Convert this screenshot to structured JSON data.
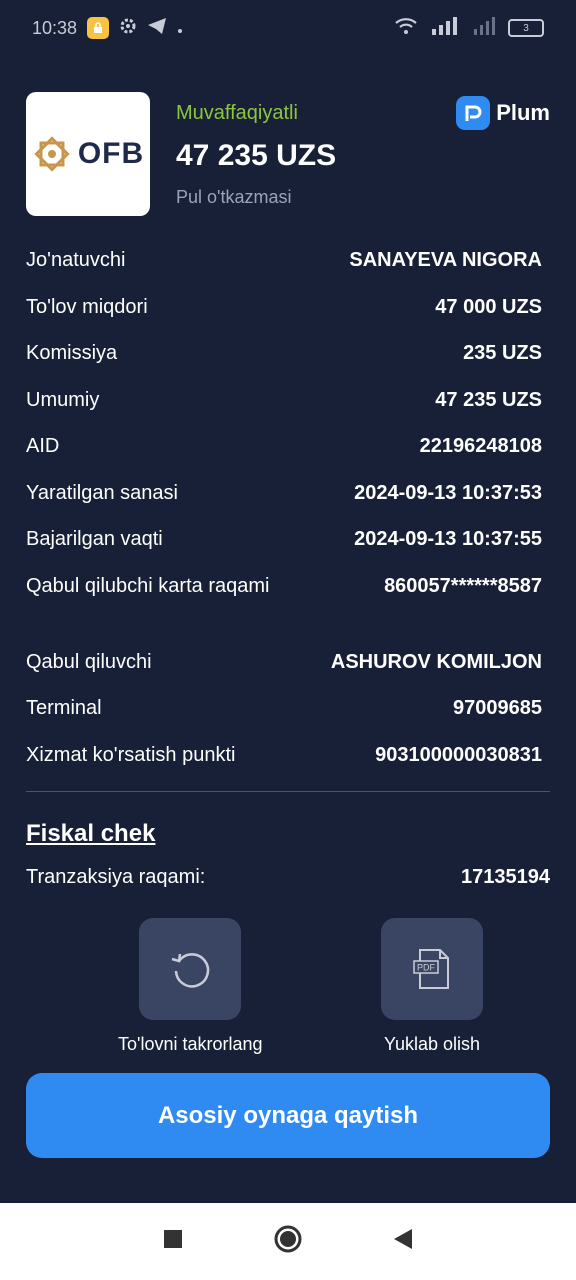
{
  "status_bar": {
    "time": "10:38",
    "battery": "3"
  },
  "header": {
    "bank_logo_text": "OFB",
    "status": "Muvaffaqiyatli",
    "amount": "47 235 UZS",
    "type": "Pul o'tkazmasi",
    "brand": "Plum"
  },
  "details": [
    {
      "label": "Jo'natuvchi",
      "value": "SANAYEVA NIGORA"
    },
    {
      "label": "To'lov miqdori",
      "value": "47 000 UZS"
    },
    {
      "label": "Komissiya",
      "value": "235 UZS"
    },
    {
      "label": "Umumiy",
      "value": "47 235 UZS"
    },
    {
      "label": "AID",
      "value": "22196248108"
    },
    {
      "label": "Yaratilgan sanasi",
      "value": "2024-09-13 10:37:53"
    },
    {
      "label": "Bajarilgan vaqti",
      "value": "2024-09-13 10:37:55"
    },
    {
      "label": "Qabul qilubchi karta raqami",
      "value": "860057******8587"
    },
    {
      "label": "Qabul qiluvchi",
      "value": "ASHUROV KOMILJON"
    },
    {
      "label": "Terminal",
      "value": "97009685"
    },
    {
      "label": "Xizmat ko'rsatish punkti",
      "value": "903100000030831"
    }
  ],
  "fiscal": {
    "title": "Fiskal chek",
    "tranz_label": "Tranzaksiya raqami:",
    "tranz_value": "17135194"
  },
  "actions": {
    "repeat_label": "To'lovni takrorlang",
    "download_label": "Yuklab olish",
    "pdf_text": "PDF"
  },
  "main_button": "Asosiy oynaga qaytish",
  "colors": {
    "background": "#172036",
    "accent": "#2f8bf1",
    "success": "#8cc63f"
  }
}
